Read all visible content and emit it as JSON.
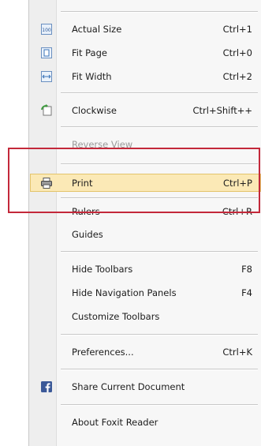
{
  "menu": {
    "items": [
      {
        "label": "Actual Size",
        "shortcut": "Ctrl+1",
        "icon": "actual-size-icon"
      },
      {
        "label": "Fit Page",
        "shortcut": "Ctrl+0",
        "icon": "fit-page-icon"
      },
      {
        "label": "Fit Width",
        "shortcut": "Ctrl+2",
        "icon": "fit-width-icon"
      },
      {
        "label": "Clockwise",
        "shortcut": "Ctrl+Shift++",
        "icon": "rotate-clockwise-icon"
      },
      {
        "label": "Reverse View",
        "shortcut": ""
      },
      {
        "label": "Print",
        "shortcut": "Ctrl+P",
        "icon": "printer-icon"
      },
      {
        "label": "Rulers",
        "shortcut": "Ctrl+R"
      },
      {
        "label": "Guides",
        "shortcut": ""
      },
      {
        "label": "Hide Toolbars",
        "shortcut": "F8"
      },
      {
        "label": "Hide Navigation Panels",
        "shortcut": "F4"
      },
      {
        "label": "Customize Toolbars",
        "shortcut": ""
      },
      {
        "label": "Preferences...",
        "shortcut": "Ctrl+K"
      },
      {
        "label": "Share Current Document",
        "shortcut": "",
        "icon": "facebook-icon"
      },
      {
        "label": "About Foxit Reader",
        "shortcut": ""
      }
    ]
  },
  "colors": {
    "highlight": "#fbe9b6",
    "annotation_box": "#c3283a"
  }
}
